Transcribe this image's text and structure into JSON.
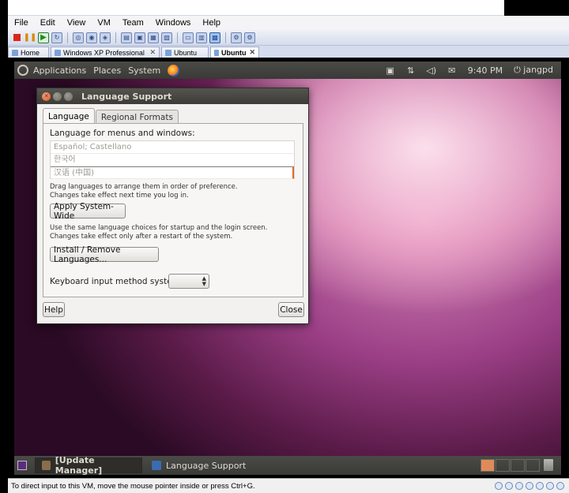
{
  "host": {
    "menu": [
      "File",
      "Edit",
      "View",
      "VM",
      "Team",
      "Windows",
      "Help"
    ],
    "tabs": [
      {
        "label": "Home"
      },
      {
        "label": "Windows XP Professional"
      },
      {
        "label": "Ubuntu"
      },
      {
        "label": "Ubuntu"
      }
    ],
    "status_text": "To direct input to this VM, move the mouse pointer inside or press Ctrl+G."
  },
  "gnome_panel": {
    "menus": [
      "Applications",
      "Places",
      "System"
    ],
    "time": "9:40 PM",
    "user": "jangpd"
  },
  "dialog": {
    "title": "Language Support",
    "tabs": [
      "Language",
      "Regional Formats"
    ],
    "menus_label": "Language for menus and windows:",
    "languages": [
      "Español; Castellano",
      "한국어",
      "汉语 (中国)"
    ],
    "drag_hint_1": "Drag languages to arrange them in order of preference.",
    "drag_hint_2": "Changes take effect next time you log in.",
    "apply_button": "Apply System-Wide",
    "apply_hint_1": "Use the same language choices for startup and the login screen.",
    "apply_hint_2": "Changes take effect only after a restart of the system.",
    "install_button": "Install / Remove Languages...",
    "keyboard_label": "Keyboard input method system:",
    "help_button": "Help",
    "close_button": "Close"
  },
  "taskbar": {
    "items": [
      "[Update Manager]",
      "Language Support"
    ]
  },
  "colors": {
    "ubuntu_orange": "#e16a2a",
    "panel_dark": "#3c3b37",
    "vmware_bar": "#d6dceb"
  }
}
